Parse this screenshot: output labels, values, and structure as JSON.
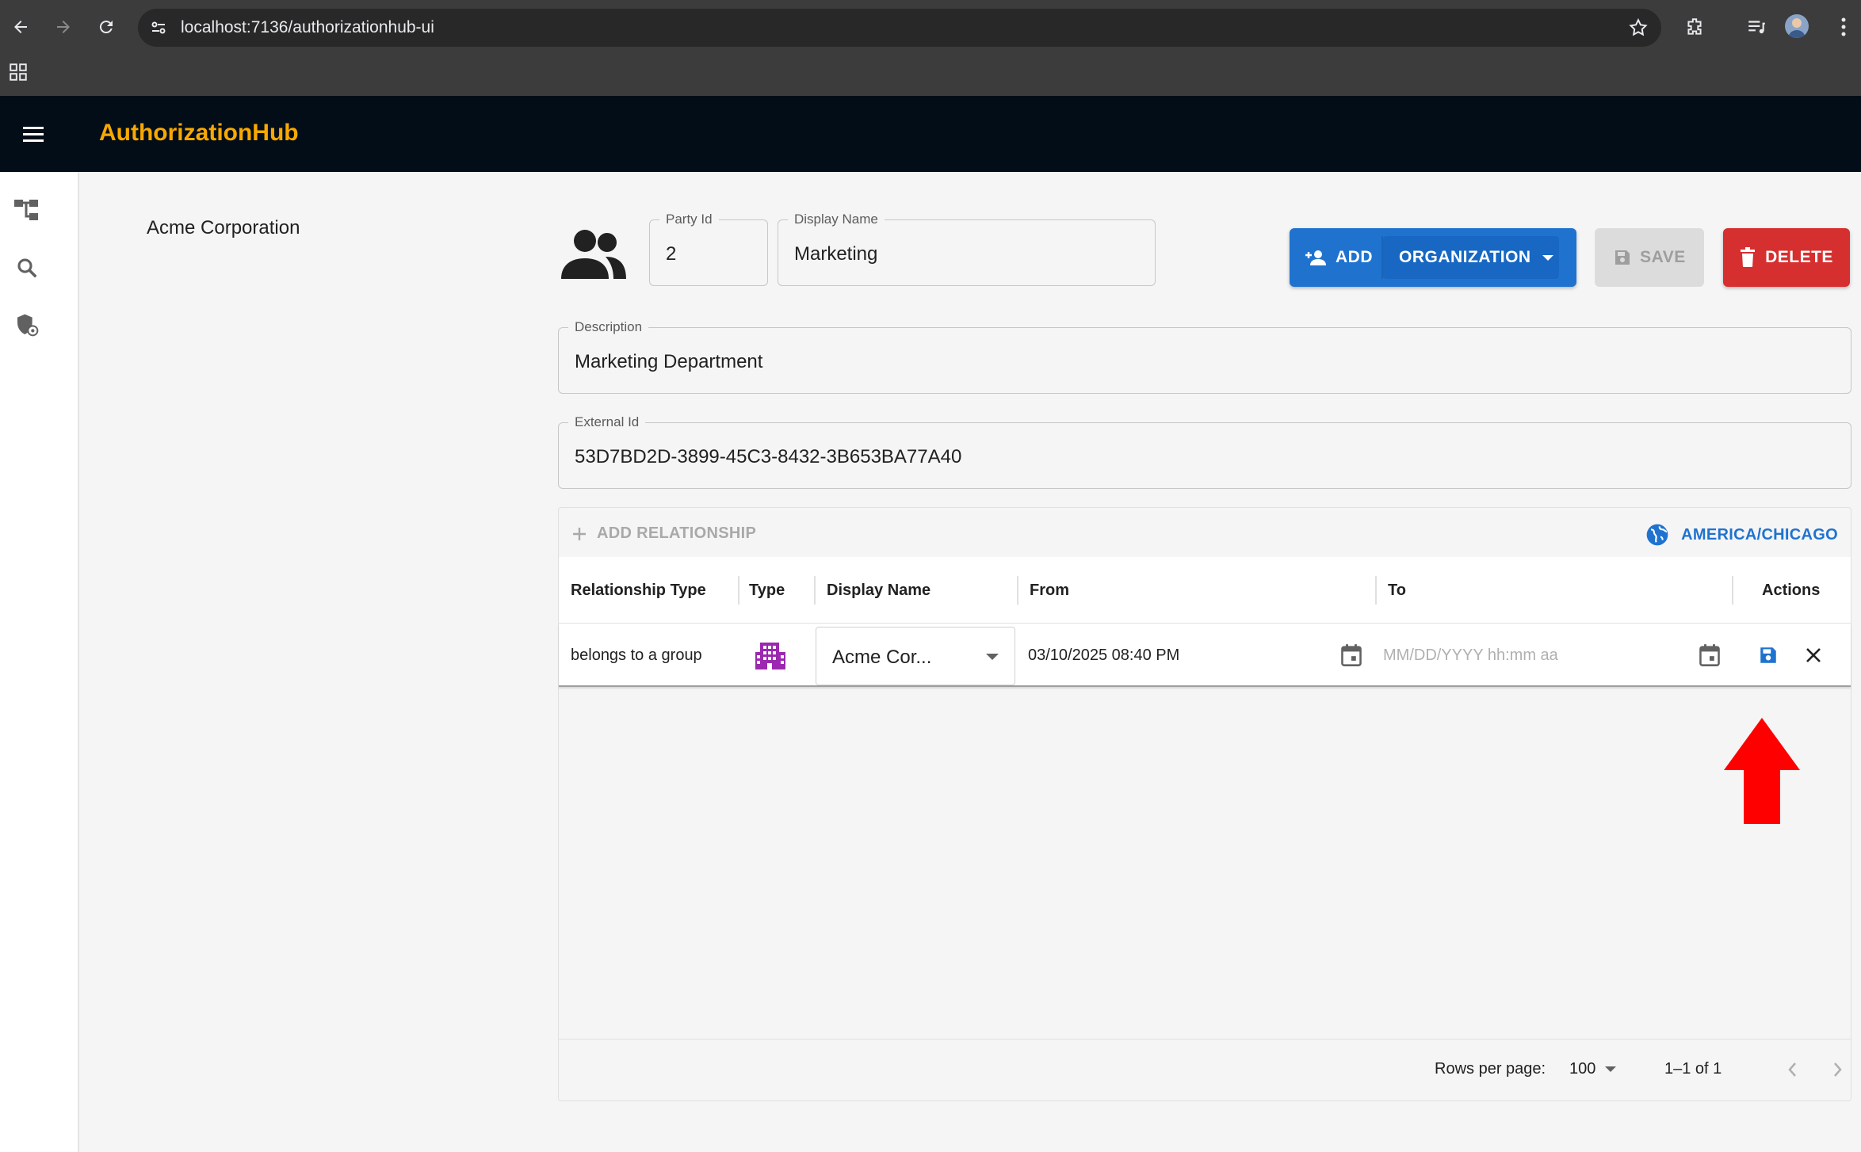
{
  "browser": {
    "url": "localhost:7136/authorizationhub-ui"
  },
  "app": {
    "title": "AuthorizationHub"
  },
  "tree": {
    "selected_item": "Acme Corporation"
  },
  "party": {
    "party_id_label": "Party Id",
    "party_id": "2",
    "display_name_label": "Display Name",
    "display_name": "Marketing",
    "description_label": "Description",
    "description": "Marketing Department",
    "external_id_label": "External Id",
    "external_id": "53D7BD2D-3899-45C3-8432-3B653BA77A40"
  },
  "actions": {
    "add_label": "ADD",
    "add_type": "ORGANIZATION",
    "save_label": "SAVE",
    "delete_label": "DELETE"
  },
  "relationships": {
    "add_label": "ADD RELATIONSHIP",
    "timezone": "AMERICA/CHICAGO",
    "columns": [
      "Relationship Type",
      "Type",
      "Display Name",
      "From",
      "To",
      "Actions"
    ],
    "rows": [
      {
        "relationship_type": "belongs to a group",
        "type_icon": "organization-icon",
        "display_name": "Acme Cor...",
        "from": "03/10/2025 08:40 PM",
        "to_placeholder": "MM/DD/YYYY hh:mm aa"
      }
    ],
    "footer": {
      "rows_per_page_label": "Rows per page:",
      "rows_per_page": "100",
      "range": "1–1 of 1"
    }
  },
  "colors": {
    "appbar": "#030d18",
    "title_accent": "#f7a900",
    "primary": "#1f73cf",
    "danger": "#d62f2f",
    "org_icon": "#9c27b0",
    "arrow": "#ff0000"
  }
}
